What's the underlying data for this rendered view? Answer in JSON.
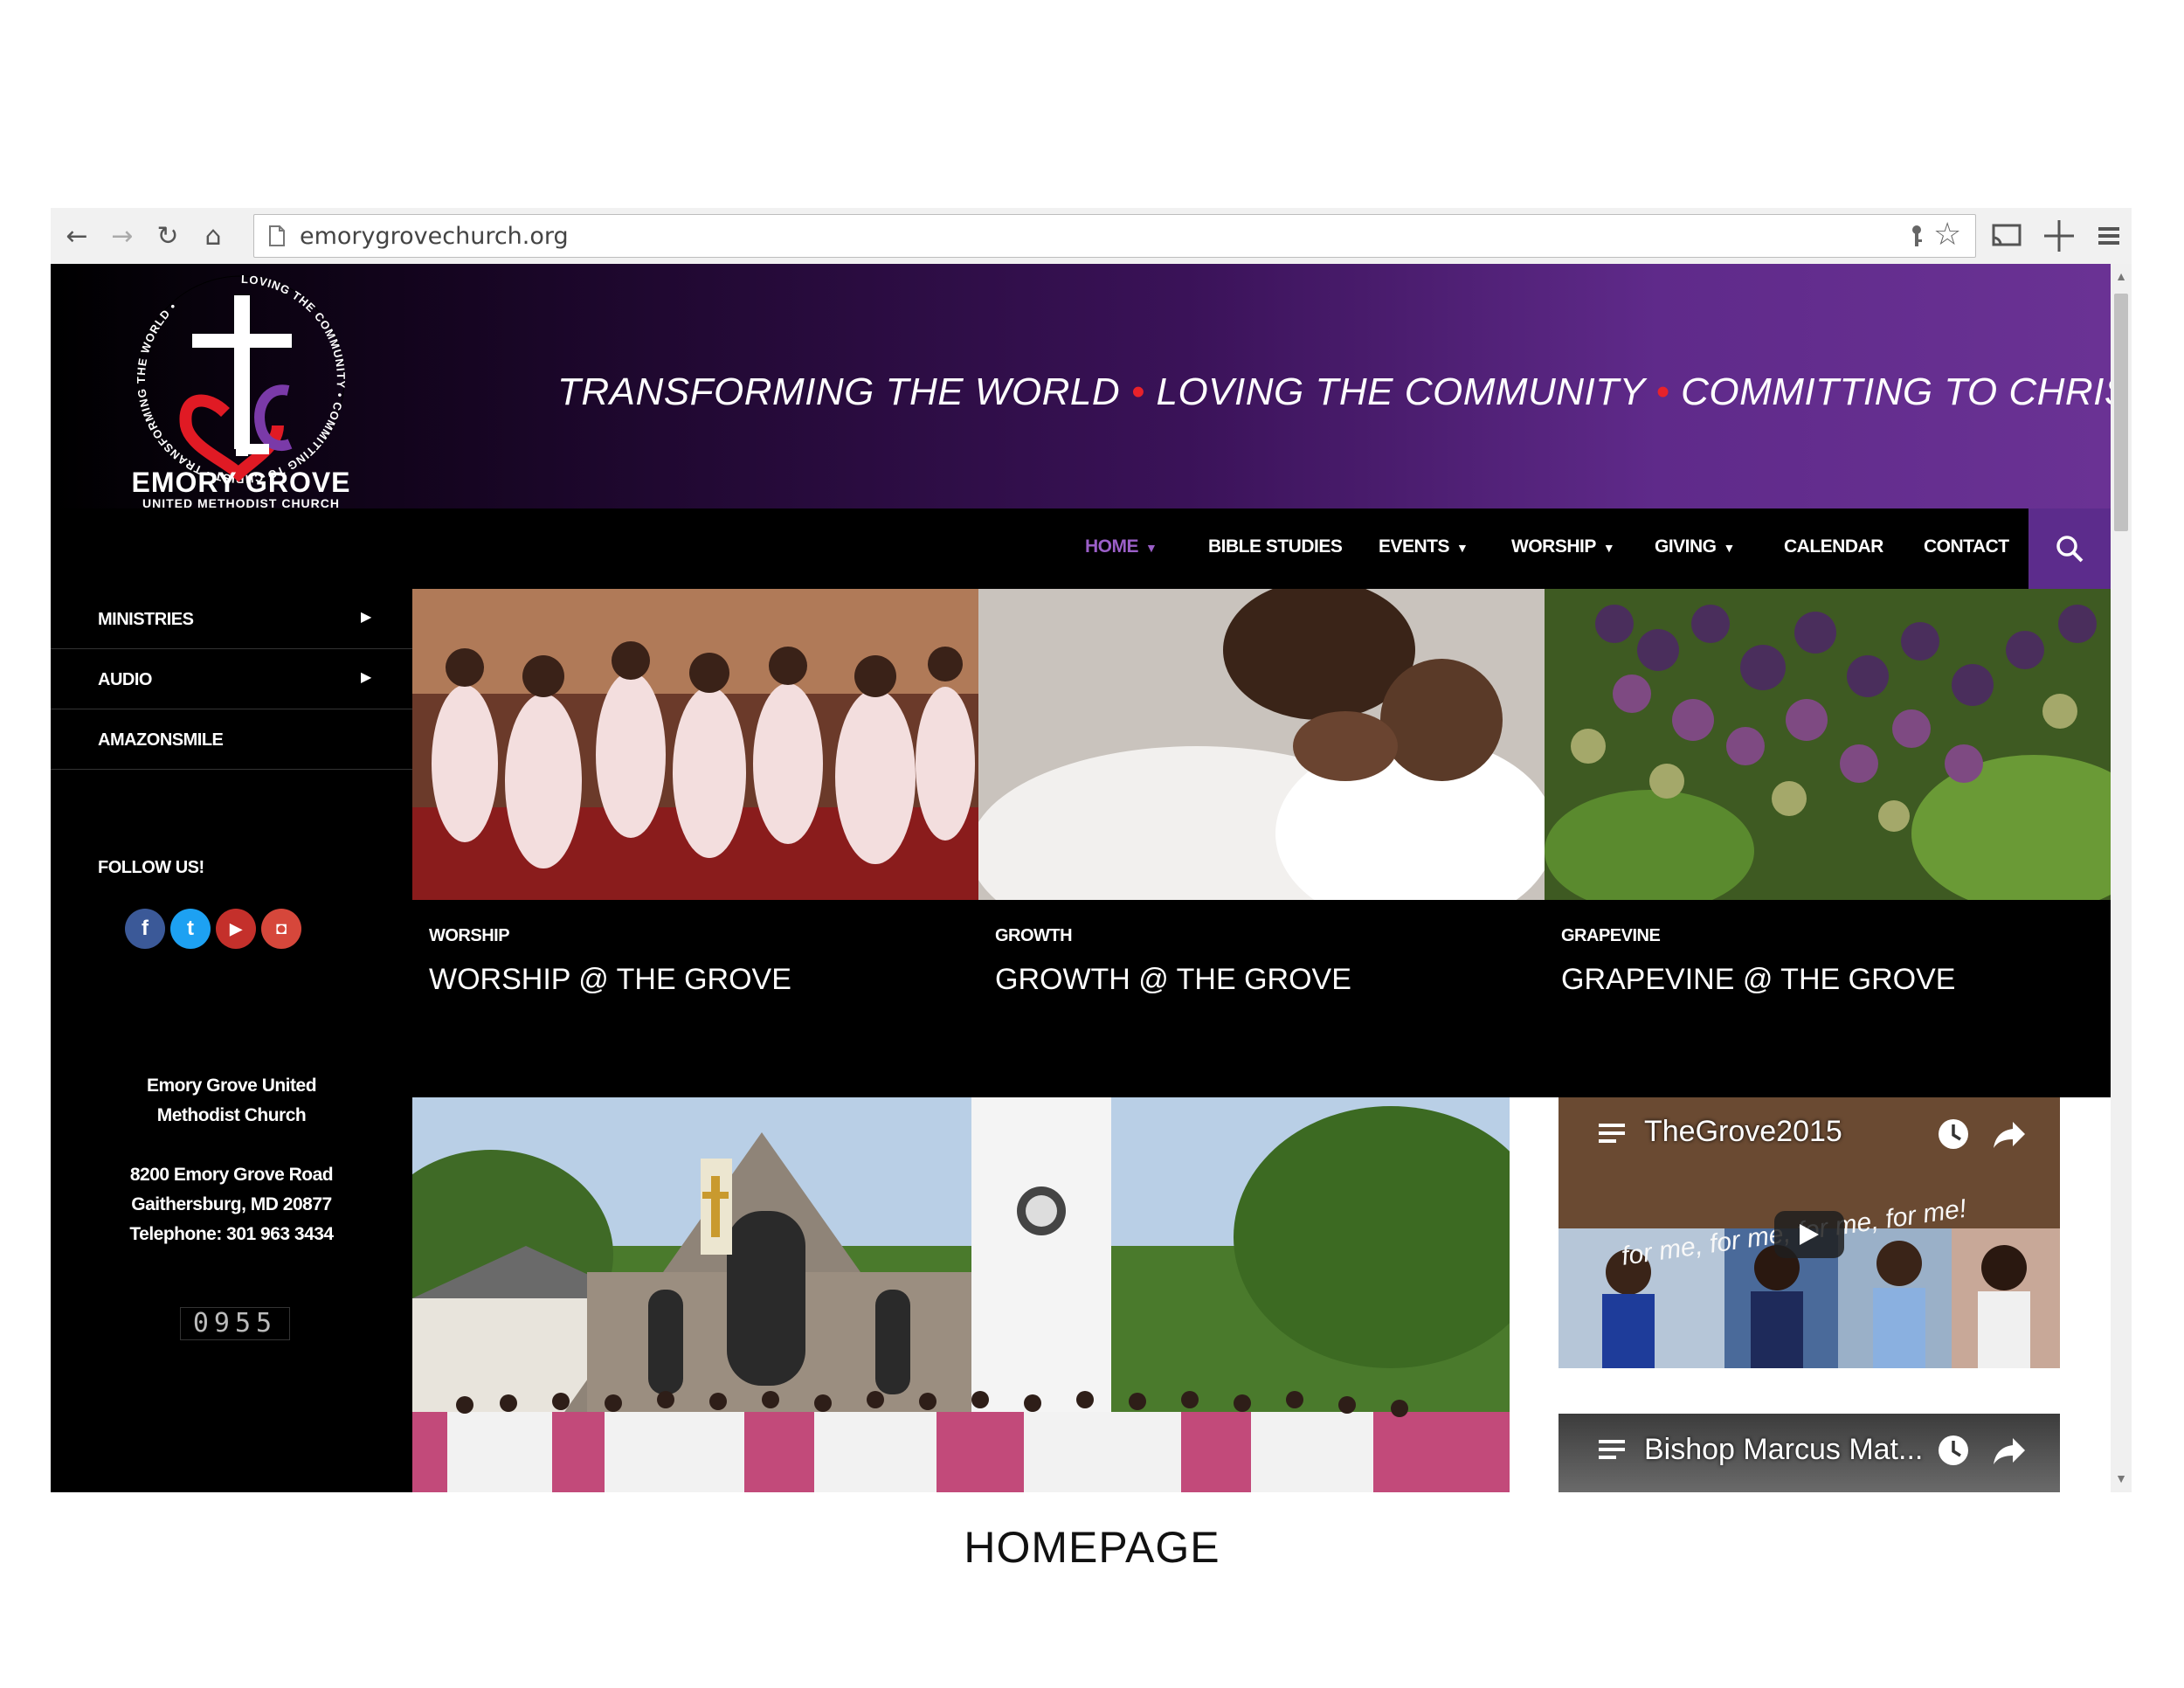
{
  "browser": {
    "url": "emorygrovechurch.org"
  },
  "header": {
    "logo_ring_text": "LOVING THE COMMUNITY • COMMITTING TO CHRIST • TRANSFORMING THE WORLD •",
    "logo_name": "EMORY GROVE",
    "logo_subtitle": "UNITED METHODIST CHURCH",
    "tagline": {
      "part1": "TRANSFORMING THE WORLD",
      "part2": "LOVING THE COMMUNITY",
      "part3": "COMMITTING TO CHRIST",
      "separator": "•"
    }
  },
  "nav": {
    "items": [
      {
        "label": "HOME",
        "dropdown": true,
        "active": true
      },
      {
        "label": "BIBLE STUDIES",
        "dropdown": false
      },
      {
        "label": "EVENTS",
        "dropdown": true
      },
      {
        "label": "WORSHIP",
        "dropdown": true
      },
      {
        "label": "GIVING",
        "dropdown": true
      },
      {
        "label": "CALENDAR",
        "dropdown": false
      },
      {
        "label": "CONTACT",
        "dropdown": false
      }
    ],
    "caret": "▼",
    "search_icon": "search-icon"
  },
  "sidebar": {
    "menu": [
      {
        "label": "MINISTRIES",
        "arrow": "▶"
      },
      {
        "label": "AUDIO",
        "arrow": "▶"
      },
      {
        "label": "AMAZONSMILE",
        "arrow": ""
      }
    ],
    "follow_label": "FOLLOW US!",
    "social": [
      {
        "name": "facebook-icon",
        "glyph": "f",
        "color": "#3b5998"
      },
      {
        "name": "twitter-icon",
        "glyph": "t",
        "color": "#1da1f2"
      },
      {
        "name": "youtube-icon",
        "glyph": "▶",
        "color": "#c4302b"
      },
      {
        "name": "instagram-icon",
        "glyph": "◘",
        "color": "#d6473b"
      }
    ],
    "address": {
      "line1": "Emory Grove United",
      "line2": "Methodist Church",
      "line3": "8200 Emory Grove Road",
      "line4": "Gaithersburg, MD 20877",
      "line5": "Telephone: 301 963 3434"
    },
    "counter": "0955"
  },
  "features": [
    {
      "category": "WORSHIP",
      "title": "WORSHIP @ THE GROVE"
    },
    {
      "category": "GROWTH",
      "title": "GROWTH @ THE GROVE"
    },
    {
      "category": "GRAPEVINE",
      "title": "GRAPEVINE @ THE GROVE"
    }
  ],
  "videos": [
    {
      "title": "TheGrove2015",
      "overlay_text": "for me, for me, for me, for me!"
    },
    {
      "title": "Bishop Marcus Mat..."
    }
  ],
  "caption": "HOMEPAGE",
  "colors": {
    "accent_purple": "#5c2c8c",
    "active_nav": "#9b5fc8",
    "tagline_dot": "#e8222a"
  }
}
